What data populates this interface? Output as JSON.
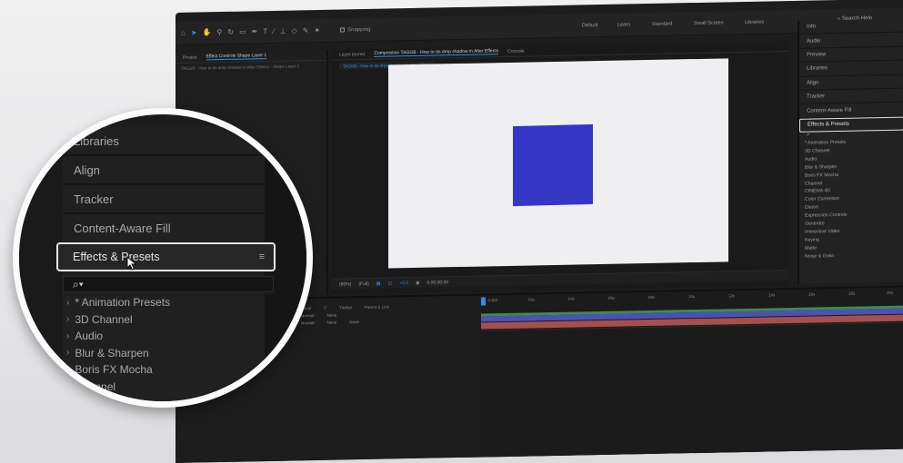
{
  "toolbar": {
    "snapping_label": "Snapping",
    "workspaces": [
      "Default",
      "Learn",
      "Standard",
      "Small Screen",
      "Libraries"
    ],
    "search_help": "Search Help"
  },
  "left_panel": {
    "tab_project": "Project",
    "tab_effect_controls": "Effect Controls Shape Layer 1",
    "subtitle": "TAGGB · How to do drop shadow in After Effects · Shape Layer 1"
  },
  "viewer": {
    "tab_layer": "Layer (none)",
    "tab_composition": "Composition TAGGB - How to do drop shadow in After Effects",
    "tab_console": "Console",
    "breadcrumb": "TAGGB - How to do drop shadow in After Effects",
    "zoom": "(80%)",
    "resolution": "(Full)",
    "exposure": "+0.0",
    "timecode": "0:00:00:00"
  },
  "right_panel": {
    "items": [
      "Info",
      "Audio",
      "Preview",
      "Libraries",
      "Align",
      "Tracker",
      "Content-Aware Fill"
    ],
    "effects_label": "Effects & Presets",
    "effects_list": [
      "* Animation Presets",
      "3D Channel",
      "Audio",
      "Blur & Sharpen",
      "Boris FX Mocha",
      "Channel",
      "CINEMA 4D",
      "Color Correction",
      "Distort",
      "Expression Controls",
      "Generate",
      "Immersive Video",
      "Keying",
      "Matte",
      "Noise & Grain"
    ]
  },
  "timeline": {
    "col_mode": "Mode",
    "col_t": "T",
    "col_trkmat": "TrkMat",
    "col_parent": "Parent & Link",
    "row1_mode": "Normal",
    "row1_parent": "None",
    "row2_mode": "Normal",
    "row2_trkmat": "None",
    "row2_parent": "None",
    "ruler_marks": [
      "0:00f",
      "02s",
      "04s",
      "06s",
      "08s",
      "10s",
      "12s",
      "14s",
      "16s",
      "18s",
      "20s"
    ]
  },
  "magnifier": {
    "items": [
      "Libraries",
      "Align",
      "Tracker",
      "Content-Aware Fill"
    ],
    "effects_label": "Effects & Presets",
    "list": [
      "* Animation Presets",
      "3D Channel",
      "Audio",
      "Blur & Sharpen",
      "Boris FX Mocha",
      "Channel"
    ]
  },
  "colors": {
    "accent": "#2d8ceb",
    "square": "#3437c6",
    "canvas": "#efeff1"
  }
}
